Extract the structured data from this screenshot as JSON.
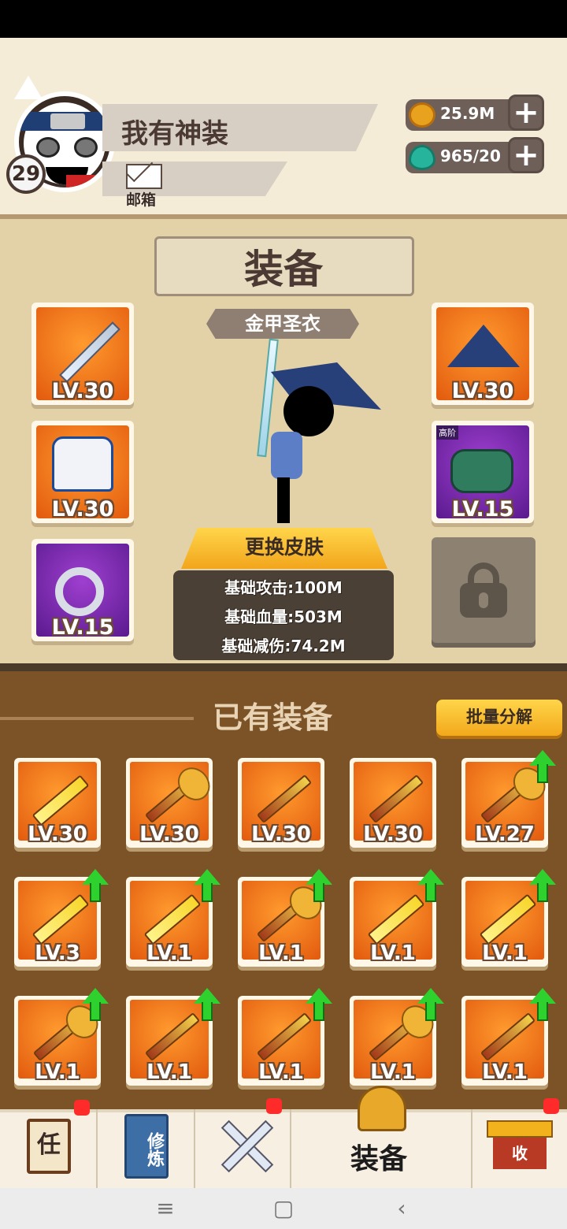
{
  "player": {
    "name": "我有神装",
    "level": "29",
    "mail_label": "邮箱"
  },
  "currencies": {
    "gold": "25.9M",
    "gems": "965/20"
  },
  "equipment": {
    "title": "装备",
    "skin_name": "金甲圣衣",
    "change_skin_label": "更换皮肤",
    "slots": {
      "weapon": "LV.30",
      "hat": "LV.30",
      "armor": "LV.30",
      "bracer": "LV.15",
      "bracer_tag": "高阶",
      "ring": "LV.15"
    },
    "stats": {
      "attack": "基础攻击:100M",
      "hp": "基础血量:503M",
      "damage_reduction": "基础减伤:74.2M"
    }
  },
  "inventory": {
    "title": "已有装备",
    "bulk_dismantle_label": "批量分解",
    "items": [
      {
        "level": "LV.30",
        "kind": "saber",
        "upgrade": false
      },
      {
        "level": "LV.30",
        "kind": "mace",
        "upgrade": false
      },
      {
        "level": "LV.30",
        "kind": "staff",
        "upgrade": false
      },
      {
        "level": "LV.30",
        "kind": "spear",
        "upgrade": false
      },
      {
        "level": "LV.27",
        "kind": "mace",
        "upgrade": true
      },
      {
        "level": "LV.3",
        "kind": "saber",
        "upgrade": true
      },
      {
        "level": "LV.1",
        "kind": "saber",
        "upgrade": true
      },
      {
        "level": "LV.1",
        "kind": "mace",
        "upgrade": true
      },
      {
        "level": "LV.1",
        "kind": "saber",
        "upgrade": true
      },
      {
        "level": "LV.1",
        "kind": "saber",
        "upgrade": true
      },
      {
        "level": "LV.1",
        "kind": "mace",
        "upgrade": true
      },
      {
        "level": "LV.1",
        "kind": "spear",
        "upgrade": true
      },
      {
        "level": "LV.1",
        "kind": "spear",
        "upgrade": true
      },
      {
        "level": "LV.1",
        "kind": "mace",
        "upgrade": true
      },
      {
        "level": "LV.1",
        "kind": "spear",
        "upgrade": true
      }
    ]
  },
  "bottom_nav": {
    "task_glyph": "任",
    "cultivate_glyph": "修炼",
    "equipment_label": "装备",
    "collect_glyph": "收"
  },
  "colors": {
    "accent_orange": "#e25a0e",
    "upgrade_green": "#2fd12f",
    "notification_red": "#ff2a2a"
  }
}
